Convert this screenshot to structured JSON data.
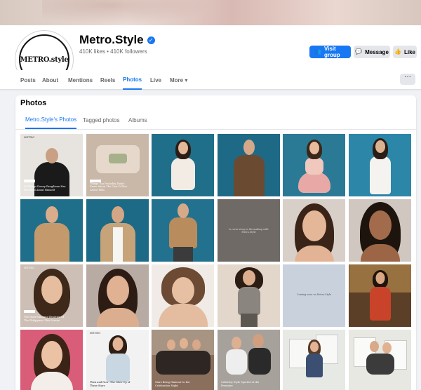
{
  "page": {
    "name": "Metro.Style",
    "stats": "410K likes • 410K followers",
    "logo_text": "METRO.style"
  },
  "actions": {
    "visit_group": "Visit group",
    "message": "Message",
    "like": "Like"
  },
  "nav_tabs": [
    "Posts",
    "About",
    "Mentions",
    "Reels",
    "Photos",
    "Live",
    "More ▾"
  ],
  "active_nav": "Photos",
  "photos": {
    "title": "Photos",
    "subtabs": [
      "Metro.Style's Photos",
      "Tagged photos",
      "Albums"
    ],
    "active_subtab": "Metro.Style's Photos"
  },
  "tiles": {
    "t01_caption": "10 Things Donny Pangilinan Has Revealed About Himself",
    "t02_caption": "Things You Probably Didn't Know About The Cast Of Her Latest Film",
    "t05_text": "A cover story in the making with Metro.Style",
    "t08_caption": "The Most Stunning Beauties Of The Philippines This Season",
    "t10_text": "Coming soon on Metro.Style",
    "t14_brand": "METRO",
    "t14_caption": "Then and Now: The Glow-Up of These Stars",
    "t15_caption": "Stars Bring Glamour to the Celebration Night",
    "t16_caption": "Celebrity Style Spotted at the Premiere"
  },
  "colors": {
    "accent": "#1877f2",
    "teal_backdrop": "#1f6f8b"
  }
}
